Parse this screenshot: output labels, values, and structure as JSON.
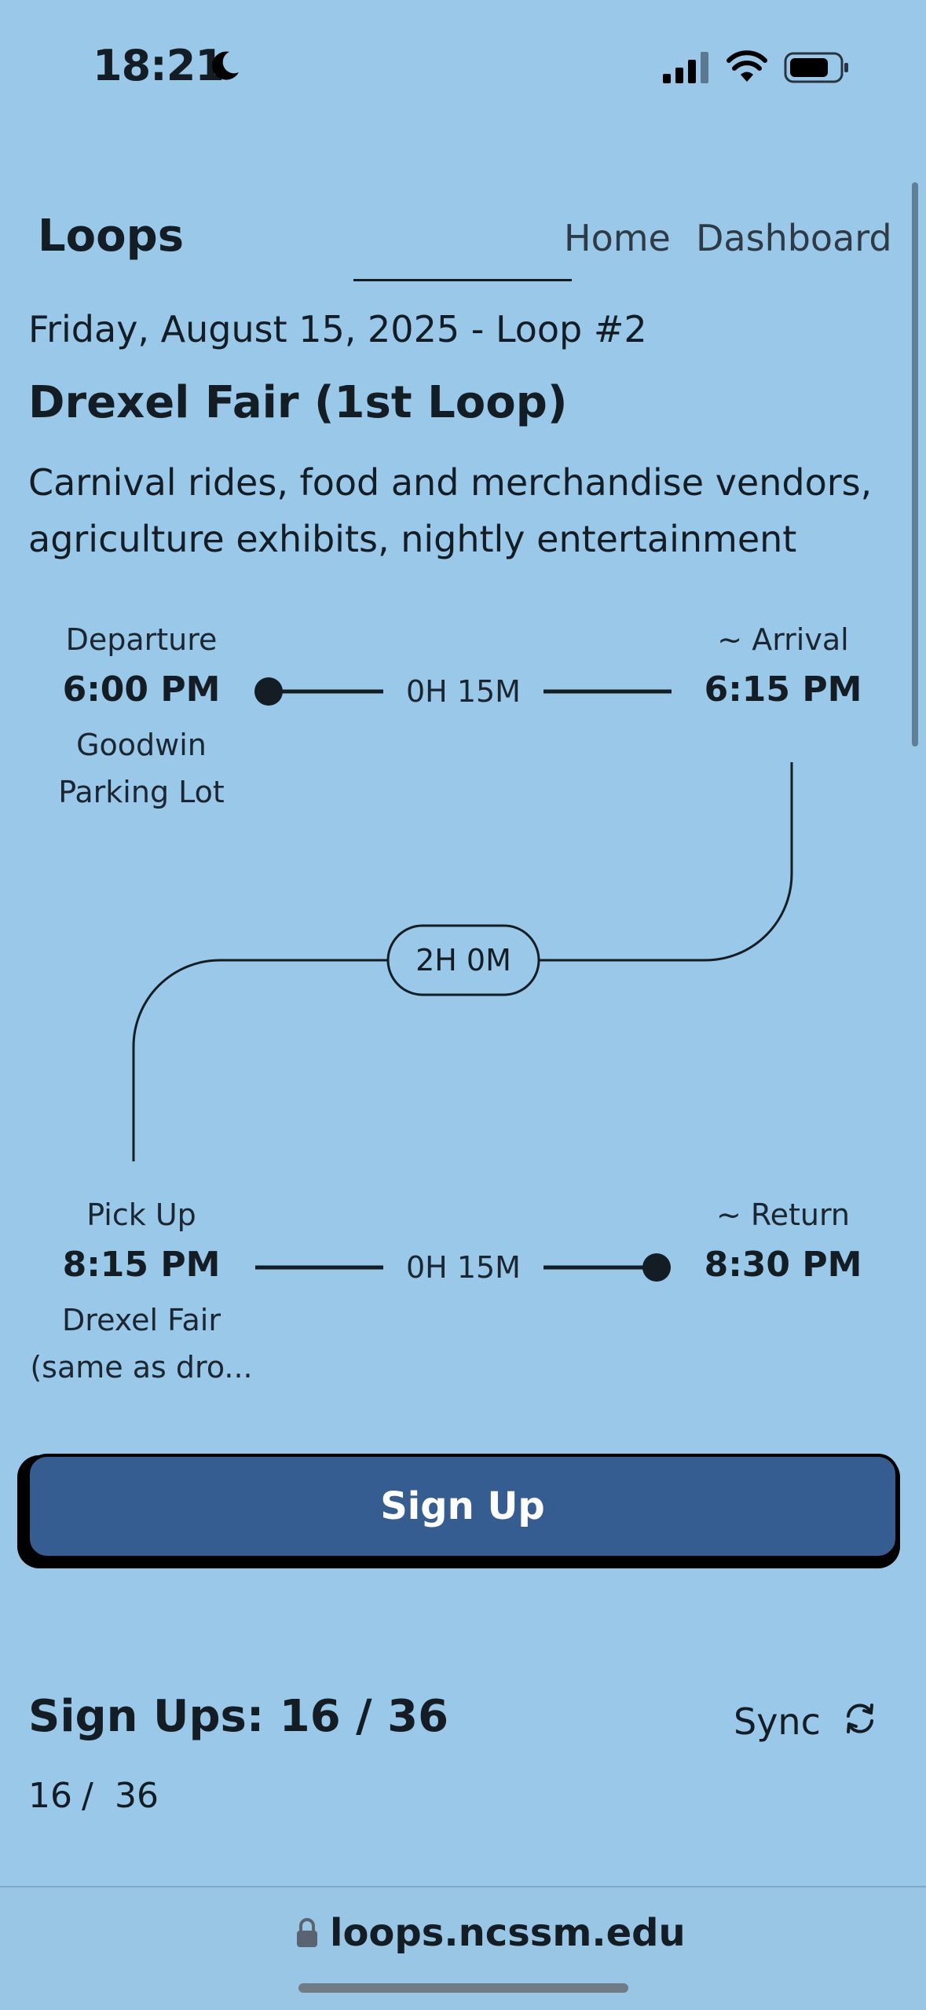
{
  "status_bar": {
    "time": "18:21"
  },
  "header": {
    "logo": "Loops",
    "nav": [
      {
        "label": "Home"
      },
      {
        "label": "Dashboard"
      }
    ]
  },
  "event": {
    "date_line": "Friday, August 15, 2025 - Loop #2",
    "title": "Drexel Fair (1st Loop)",
    "description": "Carnival rides, food and merchandise vendors, agriculture exhibits, nightly entertainment"
  },
  "outbound": {
    "departure_label": "Departure",
    "departure_time": "6:00 PM",
    "departure_location_line1": "Goodwin",
    "departure_location_line2": "Parking Lot",
    "duration": "0H 15M",
    "arrival_label": "~ Arrival",
    "arrival_time": "6:15 PM"
  },
  "stay_duration": "2H 0M",
  "inbound": {
    "pickup_label": "Pick Up",
    "pickup_time": "8:15 PM",
    "pickup_location_line1": "Drexel Fair",
    "pickup_location_line2": "(same as dro...",
    "duration": "0H 15M",
    "return_label": "~ Return",
    "return_time": "8:30 PM"
  },
  "signup_button": "Sign Up",
  "signups": {
    "title": "Sign Ups: 16 / 36",
    "sync_label": "Sync",
    "current": "16",
    "separator": "/",
    "total": "36"
  },
  "browser": {
    "url": "loops.ncssm.edu"
  },
  "colors": {
    "background": "#99c8e9",
    "button": "#355d91",
    "text": "#141c24"
  },
  "icons": [
    "moon-icon",
    "signal-icon",
    "wifi-icon",
    "battery-icon",
    "sync-icon",
    "lock-icon"
  ]
}
